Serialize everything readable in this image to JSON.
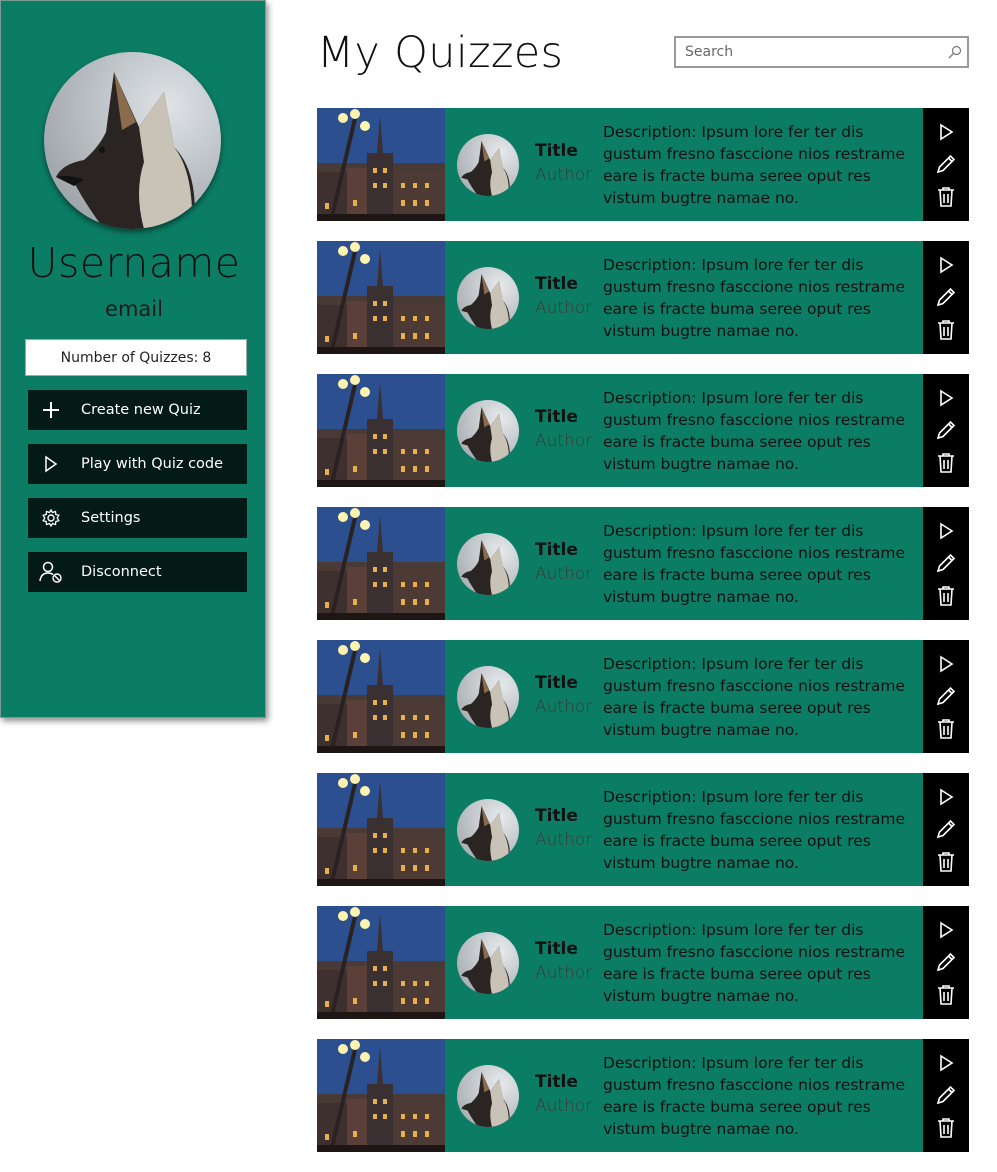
{
  "sidebar": {
    "username": "Username",
    "email": "email",
    "count_label": "Number of Quizzes:",
    "count_value": "8",
    "buttons": [
      {
        "label": "Create new Quiz",
        "icon": "plus-icon"
      },
      {
        "label": "Play with Quiz code",
        "icon": "play-icon"
      },
      {
        "label": "Settings",
        "icon": "gear-icon"
      },
      {
        "label": "Disconnect",
        "icon": "user-disconnect-icon"
      }
    ]
  },
  "main": {
    "title": "My Quizzes",
    "search_placeholder": "Search",
    "quizzes": [
      {
        "title": "Title",
        "author": "Author",
        "description": "Description: Ipsum lore fer ter dis gustum fresno fasccione nios restrame eare is fracte buma seree oput res vistum bugtre namae no."
      },
      {
        "title": "Title",
        "author": "Author",
        "description": "Description: Ipsum lore fer ter dis gustum fresno fasccione nios restrame eare is fracte buma seree oput res vistum bugtre namae no."
      },
      {
        "title": "Title",
        "author": "Author",
        "description": "Description: Ipsum lore fer ter dis gustum fresno fasccione nios restrame eare is fracte buma seree oput res vistum bugtre namae no."
      },
      {
        "title": "Title",
        "author": "Author",
        "description": "Description: Ipsum lore fer ter dis gustum fresno fasccione nios restrame eare is fracte buma seree oput res vistum bugtre namae no."
      },
      {
        "title": "Title",
        "author": "Author",
        "description": "Description: Ipsum lore fer ter dis gustum fresno fasccione nios restrame eare is fracte buma seree oput res vistum bugtre namae no."
      },
      {
        "title": "Title",
        "author": "Author",
        "description": "Description: Ipsum lore fer ter dis gustum fresno fasccione nios restrame eare is fracte buma seree oput res vistum bugtre namae no."
      },
      {
        "title": "Title",
        "author": "Author",
        "description": "Description: Ipsum lore fer ter dis gustum fresno fasccione nios restrame eare is fracte buma seree oput res vistum bugtre namae no."
      },
      {
        "title": "Title",
        "author": "Author",
        "description": "Description: Ipsum lore fer ter dis gustum fresno fasccione nios restrame eare is fracte buma seree oput res vistum bugtre namae no."
      }
    ]
  },
  "colors": {
    "accent": "#0b7d65",
    "button_bg": "#031a16",
    "actions_bg": "#000000"
  }
}
